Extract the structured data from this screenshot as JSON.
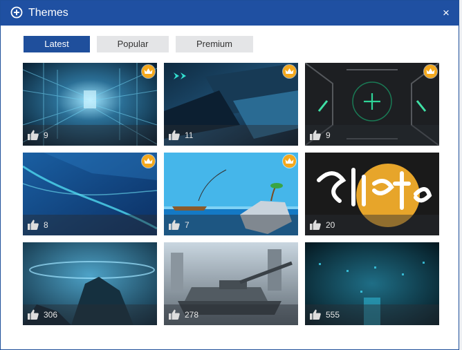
{
  "window": {
    "title": "Themes",
    "close_label": "×"
  },
  "tabs": [
    {
      "label": "Latest",
      "active": true
    },
    {
      "label": "Popular",
      "active": false
    },
    {
      "label": "Premium",
      "active": false
    }
  ],
  "themes": [
    {
      "likes": "9",
      "premium": true,
      "art": "tunnel"
    },
    {
      "likes": "11",
      "premium": true,
      "art": "scifi-panels"
    },
    {
      "likes": "9",
      "premium": true,
      "art": "hud-cross"
    },
    {
      "likes": "8",
      "premium": true,
      "art": "blue-waves"
    },
    {
      "likes": "7",
      "premium": true,
      "art": "fishing-island"
    },
    {
      "likes": "20",
      "premium": false,
      "art": "skate-graffiti"
    },
    {
      "likes": "306",
      "premium": false,
      "art": "ufo-planet"
    },
    {
      "likes": "278",
      "premium": false,
      "art": "tank"
    },
    {
      "likes": "555",
      "premium": false,
      "art": "tech-city"
    }
  ],
  "colors": {
    "titlebar": "#1f50a2",
    "tab_active": "#1f4f9c",
    "crown": "#f4a81c"
  }
}
